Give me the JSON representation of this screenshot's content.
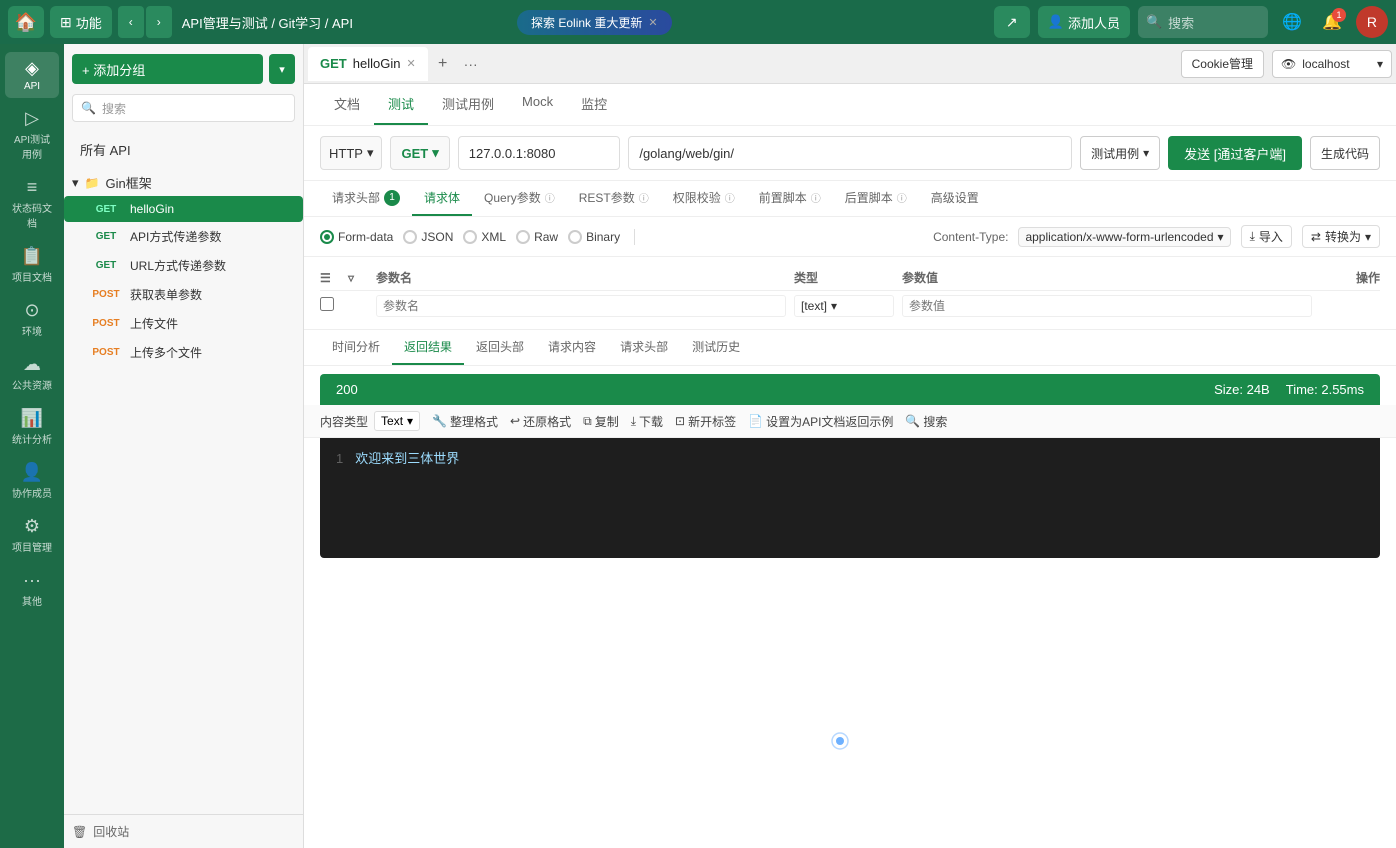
{
  "nav": {
    "home_icon": "⊞",
    "func_label": "功能",
    "breadcrumb": "API管理与测试 / Git学习 / API",
    "promo_text": "探索 Eolink 重大更新",
    "share_icon": "↗",
    "add_person_label": "添加人员",
    "search_placeholder": "搜索",
    "notification_count": "1",
    "globe_icon": "🌐"
  },
  "sidebar": {
    "items": [
      {
        "id": "api",
        "icon": "◈",
        "label": "API"
      },
      {
        "id": "api-test",
        "icon": "▶",
        "label": "API测试用例"
      },
      {
        "id": "status-doc",
        "icon": "≡",
        "label": "状态码文档"
      },
      {
        "id": "project-doc",
        "icon": "📋",
        "label": "项目文档"
      },
      {
        "id": "env",
        "icon": "⊙",
        "label": "环境"
      },
      {
        "id": "public-resource",
        "icon": "☁",
        "label": "公共资源"
      },
      {
        "id": "stats",
        "icon": "📊",
        "label": "统计分析"
      },
      {
        "id": "team",
        "icon": "👤",
        "label": "协作成员"
      },
      {
        "id": "project-mgmt",
        "icon": "⚙",
        "label": "项目管理"
      },
      {
        "id": "other",
        "icon": "···",
        "label": "其他"
      }
    ]
  },
  "api_panel": {
    "add_group_label": "+ 添加分组",
    "search_placeholder": "搜索",
    "all_api_label": "所有 API",
    "group": {
      "name": "Gin框架",
      "items": [
        {
          "method": "GET",
          "name": "helloGin",
          "active": true
        },
        {
          "method": "GET",
          "name": "API方式传递参数"
        },
        {
          "method": "GET",
          "name": "URL方式传递参数"
        },
        {
          "method": "POST",
          "name": "获取表单参数"
        },
        {
          "method": "POST",
          "name": "上传文件"
        },
        {
          "method": "POST",
          "name": "上传多个文件"
        }
      ]
    },
    "trash_label": "回收站"
  },
  "content": {
    "tab_label": "GET  helloGin",
    "cookie_btn": "Cookie管理",
    "env_label": "localhost",
    "api_tabs": [
      "文档",
      "测试",
      "测试用例",
      "Mock",
      "监控"
    ],
    "active_api_tab": "测试",
    "url_bar": {
      "protocol": "HTTP",
      "method": "GET",
      "host": "127.0.0.1:8080",
      "path": "/golang/web/gin/"
    },
    "test_example_btn": "测试用例",
    "send_btn": "发送 [通过客户端]",
    "generate_code_btn": "生成代码",
    "request_tabs": [
      {
        "label": "请求头部",
        "badge": "1"
      },
      {
        "label": "请求体",
        "active": true
      },
      {
        "label": "Query参数",
        "info": true
      },
      {
        "label": "REST参数",
        "info": true
      },
      {
        "label": "权限校验",
        "info": true
      },
      {
        "label": "前置脚本",
        "info": true
      },
      {
        "label": "后置脚本",
        "info": true
      },
      {
        "label": "高级设置"
      }
    ],
    "body_options": [
      {
        "label": "Form-data",
        "active": true
      },
      {
        "label": "JSON"
      },
      {
        "label": "XML"
      },
      {
        "label": "Raw"
      },
      {
        "label": "Binary"
      }
    ],
    "content_type_label": "Content-Type:",
    "content_type_value": "application/x-www-form-urlencoded",
    "import_btn": "导入",
    "convert_btn": "转换为",
    "table": {
      "headers": [
        "参数名",
        "类型",
        "参数值",
        "操作"
      ],
      "rows": [
        {
          "name_placeholder": "参数名",
          "type": "[text]",
          "value_placeholder": "参数值"
        }
      ]
    },
    "response_tabs": [
      "时间分析",
      "返回结果",
      "返回头部",
      "请求内容",
      "请求头部",
      "测试历史"
    ],
    "active_response_tab": "返回结果",
    "status_code": "200",
    "response_size": "Size: 24B",
    "response_time": "Time: 2.55ms",
    "response_toolbar": {
      "content_type_label": "内容类型",
      "content_type_value": "Text",
      "format_btn": "整理格式",
      "restore_btn": "还原格式",
      "copy_btn": "复制",
      "download_btn": "下载",
      "new_tab_btn": "新开标签",
      "set_example_btn": "设置为API文档返回示例",
      "search_btn": "搜索"
    },
    "response_body_line": "1",
    "response_body_text": "欢迎来到三体世界"
  }
}
